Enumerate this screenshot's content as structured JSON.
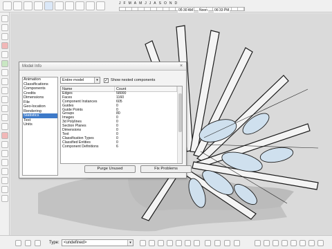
{
  "timeline": {
    "months": [
      "J",
      "F",
      "M",
      "A",
      "M",
      "J",
      "J",
      "A",
      "S",
      "O",
      "N",
      "D"
    ],
    "start_time": "05:30 AM",
    "noon": "Noon",
    "end_time": "06:33 PM"
  },
  "dialog": {
    "title": "Model Info",
    "close_glyph": "×",
    "categories": [
      "Animation",
      "Classifications",
      "Components",
      "Credits",
      "Dimensions",
      "File",
      "Geo-location",
      "Rendering",
      "Statistics",
      "Text",
      "Units"
    ],
    "selected_category": "Statistics",
    "scope_value": "Entire model",
    "scope_arrow": "▾",
    "nested_label": "Show nested components",
    "nested_checked": "✓",
    "columns": {
      "name": "Name",
      "count": "Count"
    },
    "rows": [
      {
        "name": "Edges",
        "count": "58000"
      },
      {
        "name": "Faces",
        "count": "1160"
      },
      {
        "name": "Component Instances",
        "count": "605"
      },
      {
        "name": "Guides",
        "count": "0"
      },
      {
        "name": "Guide Points",
        "count": "0"
      },
      {
        "name": "Groups",
        "count": "80"
      },
      {
        "name": "Images",
        "count": "0"
      },
      {
        "name": "3d Polylines",
        "count": "0"
      },
      {
        "name": "Section Planes",
        "count": "0"
      },
      {
        "name": "Dimensions",
        "count": "0"
      },
      {
        "name": "Text",
        "count": "0"
      },
      {
        "name": "Classification Types",
        "count": "0"
      },
      {
        "name": "Classified Entities",
        "count": "0"
      },
      {
        "name": "Component Definitions",
        "count": "6"
      }
    ],
    "purge_label": "Purge Unused",
    "fix_label": "Fix Problems"
  },
  "status": {
    "type_label": "Type:",
    "type_value": "<undefined>",
    "type_arrow": "▾"
  }
}
